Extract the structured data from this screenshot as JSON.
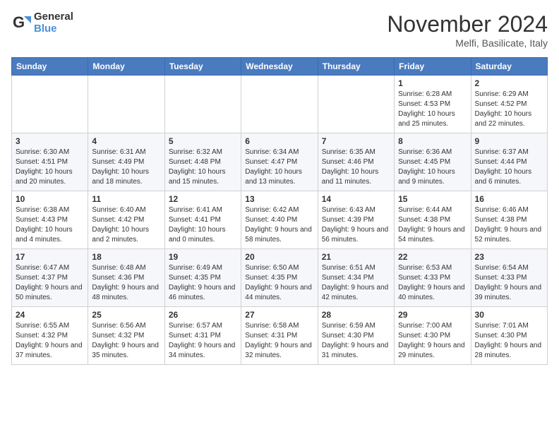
{
  "logo": {
    "general": "General",
    "blue": "Blue"
  },
  "title": "November 2024",
  "subtitle": "Melfi, Basilicate, Italy",
  "days_of_week": [
    "Sunday",
    "Monday",
    "Tuesday",
    "Wednesday",
    "Thursday",
    "Friday",
    "Saturday"
  ],
  "weeks": [
    [
      {
        "day": "",
        "info": ""
      },
      {
        "day": "",
        "info": ""
      },
      {
        "day": "",
        "info": ""
      },
      {
        "day": "",
        "info": ""
      },
      {
        "day": "",
        "info": ""
      },
      {
        "day": "1",
        "info": "Sunrise: 6:28 AM\nSunset: 4:53 PM\nDaylight: 10 hours and 25 minutes."
      },
      {
        "day": "2",
        "info": "Sunrise: 6:29 AM\nSunset: 4:52 PM\nDaylight: 10 hours and 22 minutes."
      }
    ],
    [
      {
        "day": "3",
        "info": "Sunrise: 6:30 AM\nSunset: 4:51 PM\nDaylight: 10 hours and 20 minutes."
      },
      {
        "day": "4",
        "info": "Sunrise: 6:31 AM\nSunset: 4:49 PM\nDaylight: 10 hours and 18 minutes."
      },
      {
        "day": "5",
        "info": "Sunrise: 6:32 AM\nSunset: 4:48 PM\nDaylight: 10 hours and 15 minutes."
      },
      {
        "day": "6",
        "info": "Sunrise: 6:34 AM\nSunset: 4:47 PM\nDaylight: 10 hours and 13 minutes."
      },
      {
        "day": "7",
        "info": "Sunrise: 6:35 AM\nSunset: 4:46 PM\nDaylight: 10 hours and 11 minutes."
      },
      {
        "day": "8",
        "info": "Sunrise: 6:36 AM\nSunset: 4:45 PM\nDaylight: 10 hours and 9 minutes."
      },
      {
        "day": "9",
        "info": "Sunrise: 6:37 AM\nSunset: 4:44 PM\nDaylight: 10 hours and 6 minutes."
      }
    ],
    [
      {
        "day": "10",
        "info": "Sunrise: 6:38 AM\nSunset: 4:43 PM\nDaylight: 10 hours and 4 minutes."
      },
      {
        "day": "11",
        "info": "Sunrise: 6:40 AM\nSunset: 4:42 PM\nDaylight: 10 hours and 2 minutes."
      },
      {
        "day": "12",
        "info": "Sunrise: 6:41 AM\nSunset: 4:41 PM\nDaylight: 10 hours and 0 minutes."
      },
      {
        "day": "13",
        "info": "Sunrise: 6:42 AM\nSunset: 4:40 PM\nDaylight: 9 hours and 58 minutes."
      },
      {
        "day": "14",
        "info": "Sunrise: 6:43 AM\nSunset: 4:39 PM\nDaylight: 9 hours and 56 minutes."
      },
      {
        "day": "15",
        "info": "Sunrise: 6:44 AM\nSunset: 4:38 PM\nDaylight: 9 hours and 54 minutes."
      },
      {
        "day": "16",
        "info": "Sunrise: 6:46 AM\nSunset: 4:38 PM\nDaylight: 9 hours and 52 minutes."
      }
    ],
    [
      {
        "day": "17",
        "info": "Sunrise: 6:47 AM\nSunset: 4:37 PM\nDaylight: 9 hours and 50 minutes."
      },
      {
        "day": "18",
        "info": "Sunrise: 6:48 AM\nSunset: 4:36 PM\nDaylight: 9 hours and 48 minutes."
      },
      {
        "day": "19",
        "info": "Sunrise: 6:49 AM\nSunset: 4:35 PM\nDaylight: 9 hours and 46 minutes."
      },
      {
        "day": "20",
        "info": "Sunrise: 6:50 AM\nSunset: 4:35 PM\nDaylight: 9 hours and 44 minutes."
      },
      {
        "day": "21",
        "info": "Sunrise: 6:51 AM\nSunset: 4:34 PM\nDaylight: 9 hours and 42 minutes."
      },
      {
        "day": "22",
        "info": "Sunrise: 6:53 AM\nSunset: 4:33 PM\nDaylight: 9 hours and 40 minutes."
      },
      {
        "day": "23",
        "info": "Sunrise: 6:54 AM\nSunset: 4:33 PM\nDaylight: 9 hours and 39 minutes."
      }
    ],
    [
      {
        "day": "24",
        "info": "Sunrise: 6:55 AM\nSunset: 4:32 PM\nDaylight: 9 hours and 37 minutes."
      },
      {
        "day": "25",
        "info": "Sunrise: 6:56 AM\nSunset: 4:32 PM\nDaylight: 9 hours and 35 minutes."
      },
      {
        "day": "26",
        "info": "Sunrise: 6:57 AM\nSunset: 4:31 PM\nDaylight: 9 hours and 34 minutes."
      },
      {
        "day": "27",
        "info": "Sunrise: 6:58 AM\nSunset: 4:31 PM\nDaylight: 9 hours and 32 minutes."
      },
      {
        "day": "28",
        "info": "Sunrise: 6:59 AM\nSunset: 4:30 PM\nDaylight: 9 hours and 31 minutes."
      },
      {
        "day": "29",
        "info": "Sunrise: 7:00 AM\nSunset: 4:30 PM\nDaylight: 9 hours and 29 minutes."
      },
      {
        "day": "30",
        "info": "Sunrise: 7:01 AM\nSunset: 4:30 PM\nDaylight: 9 hours and 28 minutes."
      }
    ]
  ]
}
